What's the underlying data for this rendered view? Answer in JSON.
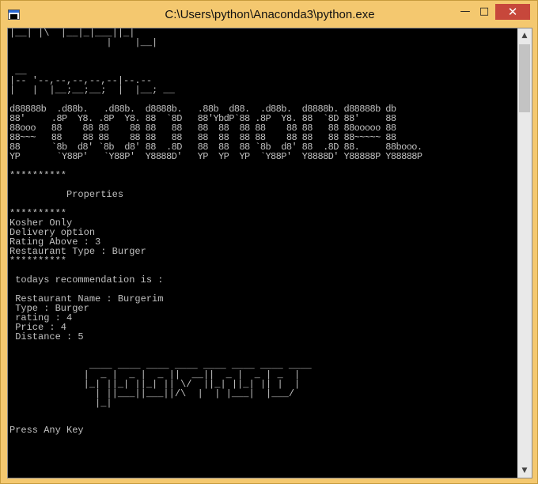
{
  "window": {
    "title": "C:\\Users\\python\\Anaconda3\\python.exe",
    "min_glyph": "—",
    "max_glyph": "□",
    "close_glyph": "✕"
  },
  "console": {
    "banner_top": "|__| |\\  |__|_|___||_|\n                 |    |__|",
    "banner_presents": " __\n|-- '--,--,--,--,--|--.--\n|   |  |__;__;__;  |  |__; __",
    "banner_foodie": "d88888b  .d88b.   .d88b.  d8888b.   .88b  d88.  .d88b.  d8888b. d88888b db\n88'     .8P  Y8. .8P  Y8. 88  `8D   88'YbdP`88 .8P  Y8. 88  `8D 88'     88\n88ooo   88    88 88    88 88   88   88  88  88 88    88 88   88 88ooooo 88\n88~~~   88    88 88    88 88   88   88  88  88 88    88 88   88 88~~~~~ 88\n88      `8b  d8' `8b  d8' 88  .8D   88  88  88 `8b  d8' 88  .8D 88.     88booo.\nYP       `Y88P'   `Y88P'  Y8888D'   YP  YP  YP  `Y88P'  Y8888D' Y88888P Y88888P",
    "body": "\n**********\n\n          Properties\n\n**********\nKosher Only\nDelivery option\nRating Above : 3\nRestaurant Type : Burger\n**********\n\n todays recommendation is :\n\n Restaurant Name : Burgerim\n Type : Burger\n rating : 4\n Price : 4\n Distance : 5\n\n",
    "banner_footer": "              ____ ____ ____ ____ ____ ____ ____ ____\n             |  _ |  _ |  _ ||  __||  _ |  _ | _  |\n             |_| ||_| ||_| || \\/  ||_| ||_| || |  |\n               | ||___||___||/\\  |  | |___|  |___/\n               |_|",
    "prompt": "Press Any Key"
  },
  "scrollbar": {
    "up_glyph": "▲",
    "down_glyph": "▼"
  }
}
